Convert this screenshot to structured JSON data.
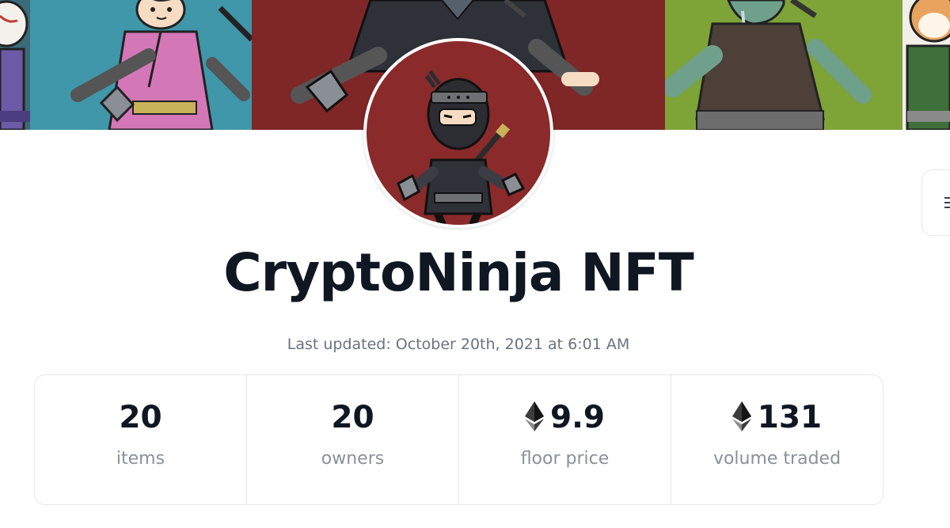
{
  "collection": {
    "name": "CryptoNinja NFT",
    "last_updated": "Last updated: October 20th, 2021 at 6:01 AM"
  },
  "banner": {
    "panels": [
      {
        "name": "fox-mask-character",
        "color": "#3b6b78"
      },
      {
        "name": "pink-kimono-ninja",
        "color": "#3f97a9"
      },
      {
        "name": "black-ninja",
        "color": "#7f2626"
      },
      {
        "name": "zombie-ninja",
        "color": "#7ea337"
      },
      {
        "name": "shiba-dog-ninja",
        "color": "#f2eee8"
      }
    ]
  },
  "avatar": {
    "name": "black-ninja-avatar",
    "background": "#8a2a2a"
  },
  "stats": [
    {
      "value": "20",
      "label": "items",
      "icon": null
    },
    {
      "value": "20",
      "label": "owners",
      "icon": null
    },
    {
      "value": "9.9",
      "label": "floor price",
      "icon": "ethereum-icon"
    },
    {
      "value": "131",
      "label": "volume traded",
      "icon": "ethereum-icon"
    }
  ],
  "colors": {
    "title": "#0f1722",
    "muted": "#6b7280",
    "border": "#e5e7eb"
  }
}
